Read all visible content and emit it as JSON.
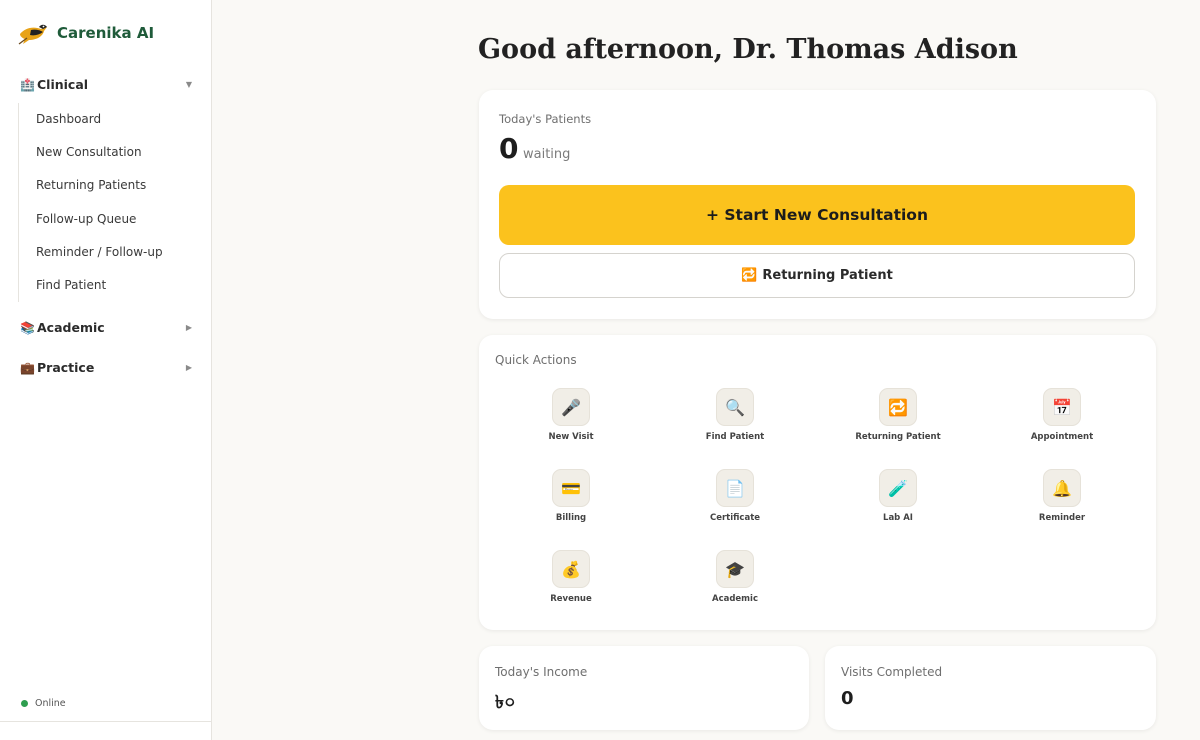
{
  "brand": {
    "name": "Carenika AI"
  },
  "sidebar": {
    "groups": [
      {
        "icon": "🏥",
        "label": "Clinical",
        "expanded": true
      },
      {
        "icon": "📚",
        "label": "Academic",
        "expanded": false
      },
      {
        "icon": "💼",
        "label": "Practice",
        "expanded": false
      }
    ],
    "clinical_items": [
      {
        "label": "Dashboard"
      },
      {
        "label": "New Consultation"
      },
      {
        "label": "Returning Patients"
      },
      {
        "label": "Follow-up Queue"
      },
      {
        "label": "Reminder / Follow-up"
      },
      {
        "label": "Find Patient"
      }
    ],
    "status": {
      "label": "Online",
      "color": "#2e9e4f"
    }
  },
  "main": {
    "greeting": "Good afternoon, Dr. Thomas Adison",
    "patients_card": {
      "label": "Today's Patients",
      "count": "0",
      "count_suffix": "waiting",
      "start_button": "+ Start New Consultation",
      "returning_icon": "🔁",
      "returning_button": "Returning Patient"
    },
    "quick_actions": {
      "title": "Quick Actions",
      "items": [
        {
          "icon": "🎤",
          "label": "New Visit"
        },
        {
          "icon": "🔍",
          "label": "Find Patient"
        },
        {
          "icon": "🔁",
          "label": "Returning Patient"
        },
        {
          "icon": "📅",
          "label": "Appointment"
        },
        {
          "icon": "💳",
          "label": "Billing"
        },
        {
          "icon": "📄",
          "label": "Certificate"
        },
        {
          "icon": "🧪",
          "label": "Lab AI"
        },
        {
          "icon": "🔔",
          "label": "Reminder"
        },
        {
          "icon": "💰",
          "label": "Revenue"
        },
        {
          "icon": "🎓",
          "label": "Academic"
        }
      ]
    },
    "income": {
      "label": "Today's Income",
      "value": "৳০"
    },
    "visits": {
      "label": "Visits Completed",
      "value": "0"
    }
  },
  "colors": {
    "accent": "#fbc21d",
    "brand": "#1f5b3a"
  }
}
